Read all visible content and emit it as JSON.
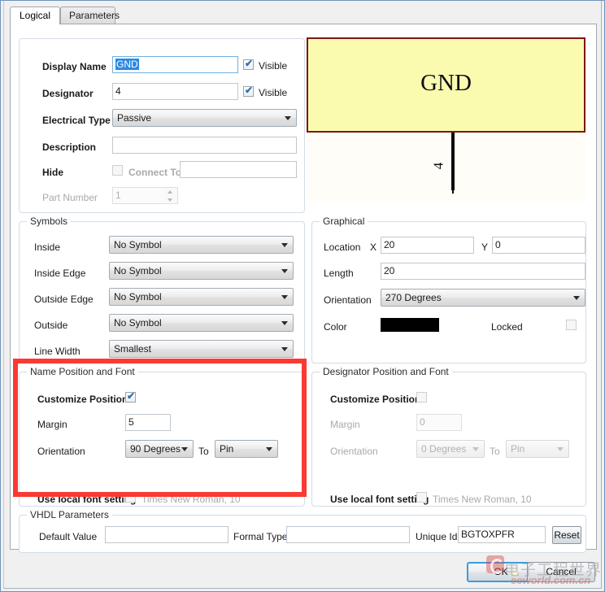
{
  "window": {
    "tabs": [
      {
        "id": "logical",
        "label": "Logical",
        "active": true
      },
      {
        "id": "parameters",
        "label": "Parameters",
        "active": false
      }
    ]
  },
  "logical": {
    "display_name": {
      "label": "Display Name",
      "value": "GND",
      "visible_label": "Visible",
      "visible_checked": true
    },
    "designator": {
      "label": "Designator",
      "value": "4",
      "visible_label": "Visible",
      "visible_checked": true
    },
    "electrical_type": {
      "label": "Electrical Type",
      "value": "Passive"
    },
    "description": {
      "label": "Description",
      "value": ""
    },
    "hide": {
      "label": "Hide",
      "checked": false,
      "connect_to_label": "Connect To",
      "connect_to_value": ""
    },
    "part_number": {
      "label": "Part Number",
      "value": "1"
    }
  },
  "preview": {
    "body_text": "GND",
    "designator_text": "4",
    "body_fill": "#fbfbb0",
    "body_border": "#7c1715",
    "pin_color": "#0a0a0a"
  },
  "symbols": {
    "legend": "Symbols",
    "rows": [
      {
        "label": "Inside",
        "value": "No Symbol"
      },
      {
        "label": "Inside Edge",
        "value": "No Symbol"
      },
      {
        "label": "Outside Edge",
        "value": "No Symbol"
      },
      {
        "label": "Outside",
        "value": "No Symbol"
      },
      {
        "label": "Line Width",
        "value": "Smallest"
      }
    ]
  },
  "graphical": {
    "legend": "Graphical",
    "location_label": "Location",
    "x_label": "X",
    "x_value": "20",
    "y_label": "Y",
    "y_value": "0",
    "length_label": "Length",
    "length_value": "20",
    "orientation_label": "Orientation",
    "orientation_value": "270 Degrees",
    "color_label": "Color",
    "color_value": "#000000",
    "locked_label": "Locked",
    "locked_checked": false
  },
  "name_position": {
    "legend": "Name Position and Font",
    "customize_label": "Customize Position",
    "customize_checked": true,
    "margin_label": "Margin",
    "margin_value": "5",
    "orientation_label": "Orientation",
    "orientation_value": "90 Degrees",
    "to_label": "To",
    "to_value": "Pin",
    "local_font_label": "Use local font setting",
    "local_font_checked": false,
    "font_value": "Times New Roman, 10",
    "highlight_color": "#fa3a33"
  },
  "designator_position": {
    "legend": "Designator Position and Font",
    "customize_label": "Customize Position",
    "customize_checked": false,
    "margin_label": "Margin",
    "margin_value": "0",
    "orientation_label": "Orientation",
    "orientation_value": "0 Degrees",
    "to_label": "To",
    "to_value": "Pin",
    "local_font_label": "Use local font setting",
    "local_font_checked": false,
    "font_value": "Times New Roman, 10"
  },
  "vhdl": {
    "legend": "VHDL Parameters",
    "default_value_label": "Default Value",
    "default_value": "",
    "formal_type_label": "Formal Type",
    "formal_type": "",
    "unique_id_label": "Unique Id",
    "unique_id": "BGTOXPFR",
    "reset_label": "Reset"
  },
  "footer": {
    "ok_label": "OK",
    "cancel_label": "Cancel"
  },
  "watermark": {
    "cn": "电子工程世界",
    "en": "eeworld.com.cn"
  }
}
